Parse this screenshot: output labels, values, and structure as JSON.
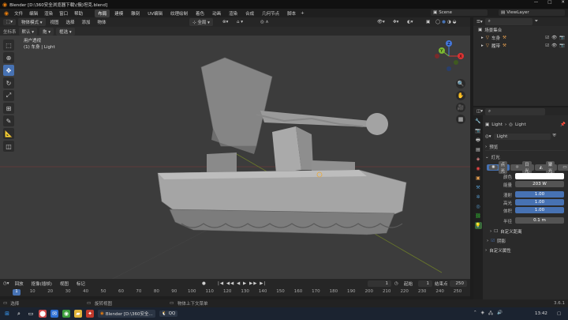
{
  "window": {
    "title": "Blender [D:\\360安全浏览器下载\\(俄)坦克.blend]",
    "controls": [
      "—",
      "□",
      "✕"
    ]
  },
  "menu": [
    "文件",
    "编辑",
    "渲染",
    "窗口",
    "帮助"
  ],
  "workspaces": [
    "布局",
    "建模",
    "雕刻",
    "UV编辑",
    "纹理绘制",
    "着色",
    "动画",
    "渲染",
    "合成",
    "几何节点",
    "脚本"
  ],
  "active_workspace": "布局",
  "scene": {
    "label": "Scene",
    "view_layer": "ViewLayer"
  },
  "viewport_header": {
    "mode": "物体模式",
    "menus": [
      "视图",
      "选择",
      "添加",
      "物体"
    ],
    "orientation": "全局"
  },
  "viewport_header2": {
    "transform_label": "坐标系",
    "orientation": "默认",
    "drag": "拖",
    "select": "框选"
  },
  "viewport_info": {
    "line1": "用户透视",
    "line2": "(1) 车身 | Light"
  },
  "gizmo": {
    "x": "X",
    "y": "Y",
    "z": "Z"
  },
  "outliner": {
    "title": "场景集合",
    "items": [
      {
        "name": "车身"
      },
      {
        "name": "履带"
      }
    ]
  },
  "properties": {
    "breadcrumb_obj": "Light",
    "breadcrumb_data": "Light",
    "datablock": "Light",
    "section_preview": "预览",
    "section_light": "灯光",
    "light_types": [
      "点光",
      "日光",
      "聚光",
      "面光"
    ],
    "active_type": "点光",
    "color_label": "颜色",
    "power_label": "能量",
    "power_value": "203 W",
    "diffuse_label": "漫射",
    "diffuse_value": "1.00",
    "specular_label": "高光",
    "specular_value": "1.00",
    "volume_label": "体积",
    "volume_value": "1.00",
    "radius_label": "半径",
    "radius_value": "0.1 m",
    "custom_distance": "自定义距离",
    "shadow": "阴影",
    "custom_props": "自定义属性"
  },
  "timeline_header": {
    "playback": "回放",
    "keying": "抠像(插帧)",
    "view": "视图",
    "marker": "标记",
    "current_frame": "1",
    "start_label": "起始",
    "start": "1",
    "end_label": "结束点",
    "end": "250"
  },
  "timeline_ticks": [
    "1",
    "10",
    "20",
    "30",
    "40",
    "50",
    "60",
    "70",
    "80",
    "90",
    "100",
    "110",
    "120",
    "130",
    "140",
    "150",
    "160",
    "170",
    "180",
    "190",
    "200",
    "210",
    "220",
    "230",
    "240",
    "250"
  ],
  "statusbar": {
    "select": "选择",
    "rotate": "旋转视图",
    "context": "物体上下文菜单",
    "version": "3.6.1"
  },
  "taskbar": {
    "blender_app": "Blender [D:\\360安全...",
    "qq_app": "QQ",
    "time": "13:42"
  }
}
